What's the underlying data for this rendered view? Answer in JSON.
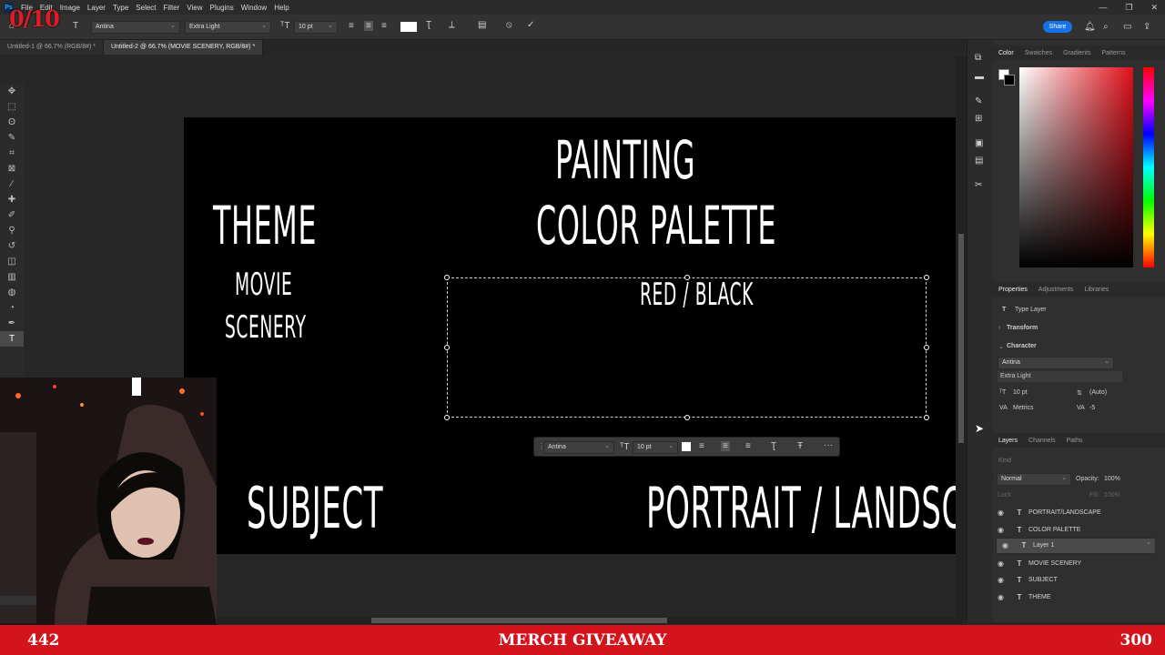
{
  "app": {
    "logo": "Ps"
  },
  "stream": {
    "goal_counter": "0/10",
    "banner_left": "442",
    "banner_center": "MERCH GIVEAWAY",
    "banner_right": "300"
  },
  "menu": [
    "File",
    "Edit",
    "Image",
    "Layer",
    "Type",
    "Select",
    "Filter",
    "View",
    "Plugins",
    "Window",
    "Help"
  ],
  "options": {
    "font_family": "Antina",
    "font_style": "Extra Light",
    "font_size": "10 pt",
    "share_label": "Share"
  },
  "tabs": [
    {
      "label": "Untitled-1 @ 66.7% (RGB/8#) *",
      "active": false
    },
    {
      "label": "Untitled-2 @ 66.7% (MOVIE SCENERY, RGB/8#) *",
      "active": true
    }
  ],
  "canvas": {
    "painting": "PAINTING",
    "color_palette": "COLOR PALETTE",
    "theme": "THEME",
    "movie": "MOVIE",
    "scenery": "SCENERY",
    "red_black": "RED / BLACK",
    "subject": "SUBJECT",
    "portrait_landscape": "PORTRAIT / LANDSCAPE"
  },
  "contextbar": {
    "font_family": "Antina",
    "font_size": "10 pt"
  },
  "color_panel": {
    "tabs": [
      "Color",
      "Swatches",
      "Gradients",
      "Patterns"
    ],
    "active": "Color",
    "hue_color": "#e0101a"
  },
  "properties": {
    "tabs": [
      "Properties",
      "Adjustments",
      "Libraries"
    ],
    "layer_type": "Type Layer",
    "transform_label": "Transform",
    "character_label": "Character",
    "font_family": "Antina",
    "font_style": "Extra Light",
    "font_size": "10 pt",
    "leading": "(Auto)",
    "kerning": "Metrics",
    "tracking": "-5"
  },
  "layers_panel": {
    "tabs": [
      "Layers",
      "Channels",
      "Paths"
    ],
    "search_placeholder": "Kind",
    "blend_mode": "Normal",
    "opacity_label": "Opacity:",
    "opacity": "100%",
    "lock_label": "Lock:",
    "fill_label": "Fill:",
    "fill": "100%",
    "layers": [
      {
        "name": "PORTRAIT/LANDSCAPE",
        "selected": false
      },
      {
        "name": "COLOR PALETTE",
        "selected": false
      },
      {
        "name": "Layer 1",
        "selected": true
      },
      {
        "name": "MOVIE SCENERY",
        "selected": false
      },
      {
        "name": "SUBJECT",
        "selected": false
      },
      {
        "name": "THEME",
        "selected": false
      }
    ]
  },
  "colors": {
    "accent": "#1473e6",
    "banner": "#d4141c",
    "counter": "#e01b24"
  }
}
